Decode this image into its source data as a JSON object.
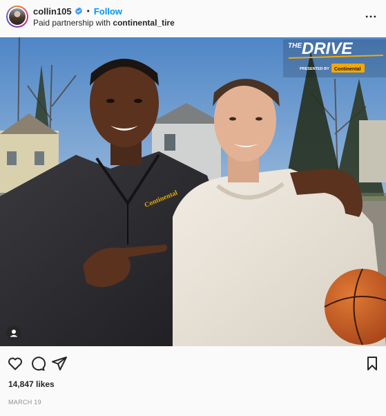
{
  "post": {
    "username": "collin105",
    "follow_label": "Follow",
    "partnership_prefix": "Paid partnership with",
    "partner_name": "continental_tire",
    "likes": "14,847 likes",
    "date": "MARCH 19"
  },
  "photo_overlay": {
    "brand_the": "THE",
    "brand_drive": "DRIVE",
    "presented_by": "PRESENTED BY",
    "sponsor_logo": "Continental",
    "sweatshirt_logo": "Continental"
  },
  "icons": {
    "verified": "verified-badge-icon",
    "more": "more-options-icon",
    "like": "heart-icon",
    "comment": "comment-icon",
    "share": "share-icon",
    "save": "bookmark-icon",
    "tag": "user-tag-icon"
  },
  "colors": {
    "follow_blue": "#0095f6",
    "verified_blue": "#3897f0",
    "text": "#262626",
    "muted": "#8e8e8e",
    "brand_yellow": "#f5a800"
  }
}
